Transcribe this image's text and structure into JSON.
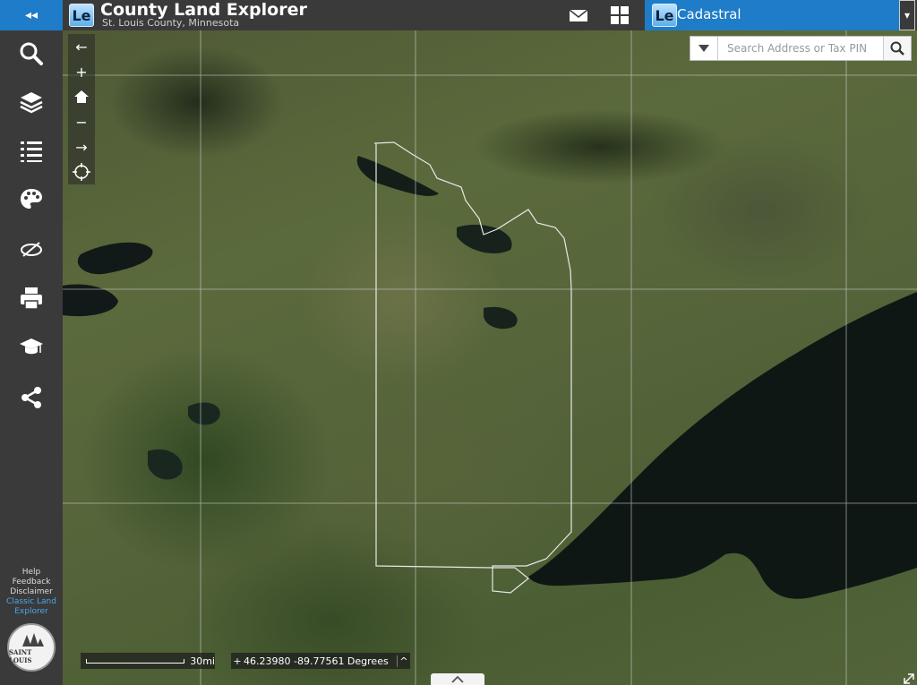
{
  "app": {
    "title": "County Land Explorer",
    "subtitle": "St. Louis County, Minnesota",
    "logo_text": "Le"
  },
  "sidebar": {
    "collapse_label": "◂◂",
    "tools": [
      {
        "name": "search-tool",
        "icon": "search-icon"
      },
      {
        "name": "layers-tool",
        "icon": "layers-icon"
      },
      {
        "name": "legend-tool",
        "icon": "list-icon"
      },
      {
        "name": "basemap-tool",
        "icon": "palette-icon"
      },
      {
        "name": "measure-tool",
        "icon": "measure-icon"
      },
      {
        "name": "print-tool",
        "icon": "printer-icon"
      },
      {
        "name": "tutorial-tool",
        "icon": "graduation-cap-icon"
      },
      {
        "name": "share-tool",
        "icon": "share-icon"
      }
    ],
    "links": {
      "help": "Help",
      "feedback": "Feedback",
      "disclaimer": "Disclaimer",
      "classic_line1": "Classic Land",
      "classic_line2": "Explorer"
    },
    "seal_text": "SAINT LOUIS"
  },
  "header": {
    "layer": {
      "logo_text": "Le",
      "name": "Cadastral"
    },
    "dropdown_arrow": "▾"
  },
  "map": {
    "nav": {
      "back": "←",
      "zoom_in": "+",
      "zoom_out": "−",
      "forward": "→"
    },
    "search": {
      "placeholder": "Search Address or Tax PIN"
    },
    "scale": {
      "label": "30mi"
    },
    "coordinates": {
      "toggle_left": "+",
      "text": "46.23980 -89.77561 Degrees",
      "toggle_right": "^"
    }
  },
  "colors": {
    "accent": "#1e7cc8",
    "sidebar_bg": "#3a3a3a",
    "lake": "#111a18"
  }
}
